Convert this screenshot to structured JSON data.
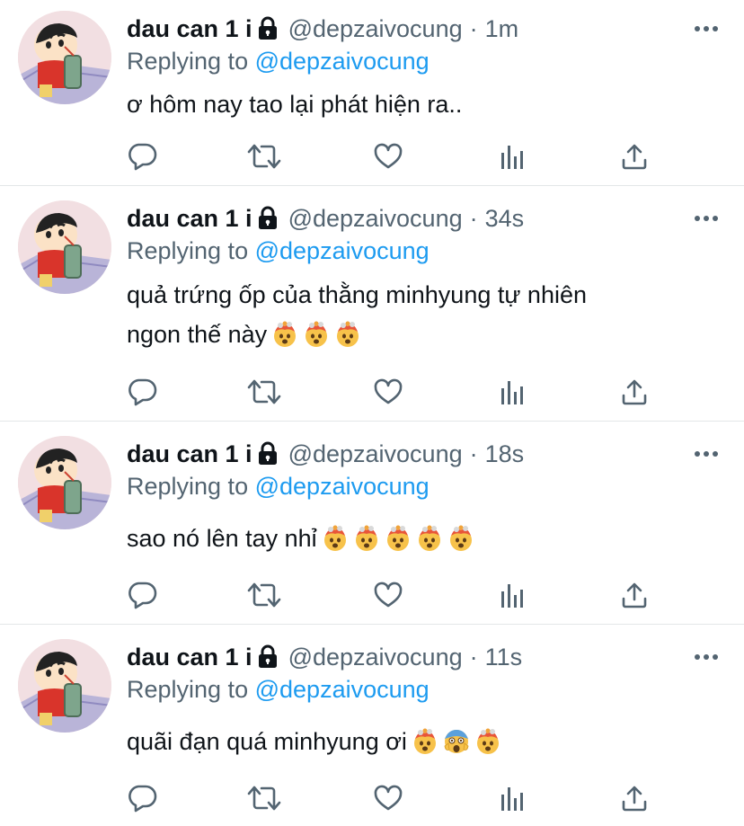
{
  "tweets": [
    {
      "display_name": "dau can 1 i",
      "handle": "@depzaivocung",
      "dot": "·",
      "time": "1m",
      "replying_prefix": "Replying to",
      "replying_handle": "@depzaivocung",
      "text": "ơ hôm nay tao lại phát hiện ra..",
      "emojis": []
    },
    {
      "display_name": "dau can 1 i",
      "handle": "@depzaivocung",
      "dot": "·",
      "time": "34s",
      "replying_prefix": "Replying to",
      "replying_handle": "@depzaivocung",
      "text_line1": "quả trứng ốp của thằng minhyung tự nhiên",
      "text_line2": "ngon thế này",
      "emojis": [
        "exploding-head",
        "exploding-head",
        "exploding-head"
      ]
    },
    {
      "display_name": "dau can 1 i",
      "handle": "@depzaivocung",
      "dot": "·",
      "time": "18s",
      "replying_prefix": "Replying to",
      "replying_handle": "@depzaivocung",
      "text": "sao nó lên tay nhỉ",
      "emojis": [
        "exploding-head",
        "exploding-head",
        "exploding-head",
        "exploding-head",
        "exploding-head"
      ]
    },
    {
      "display_name": "dau can 1 i",
      "handle": "@depzaivocung",
      "dot": "·",
      "time": "11s",
      "replying_prefix": "Replying to",
      "replying_handle": "@depzaivocung",
      "text": "quãi đạn quá minhyung ơi",
      "emojis": [
        "exploding-head",
        "screaming-face",
        "exploding-head"
      ]
    }
  ],
  "icons": {
    "lock": "lock-icon",
    "more": "more-icon",
    "reply": "reply-icon",
    "retweet": "retweet-icon",
    "like": "heart-icon",
    "analytics": "analytics-icon",
    "share": "share-icon"
  },
  "colors": {
    "link": "#1d9bf0",
    "muted": "#536471",
    "text": "#0f1419",
    "border": "#e3e6e8"
  }
}
